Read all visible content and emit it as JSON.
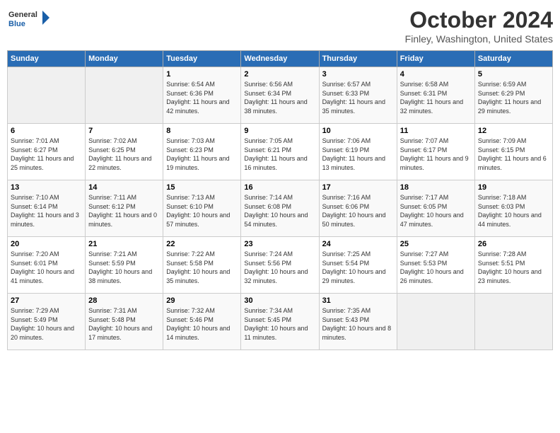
{
  "header": {
    "logo_line1": "General",
    "logo_line2": "Blue",
    "month": "October 2024",
    "location": "Finley, Washington, United States"
  },
  "weekdays": [
    "Sunday",
    "Monday",
    "Tuesday",
    "Wednesday",
    "Thursday",
    "Friday",
    "Saturday"
  ],
  "weeks": [
    [
      {
        "day": "",
        "info": ""
      },
      {
        "day": "",
        "info": ""
      },
      {
        "day": "1",
        "info": "Sunrise: 6:54 AM\nSunset: 6:36 PM\nDaylight: 11 hours and 42 minutes."
      },
      {
        "day": "2",
        "info": "Sunrise: 6:56 AM\nSunset: 6:34 PM\nDaylight: 11 hours and 38 minutes."
      },
      {
        "day": "3",
        "info": "Sunrise: 6:57 AM\nSunset: 6:33 PM\nDaylight: 11 hours and 35 minutes."
      },
      {
        "day": "4",
        "info": "Sunrise: 6:58 AM\nSunset: 6:31 PM\nDaylight: 11 hours and 32 minutes."
      },
      {
        "day": "5",
        "info": "Sunrise: 6:59 AM\nSunset: 6:29 PM\nDaylight: 11 hours and 29 minutes."
      }
    ],
    [
      {
        "day": "6",
        "info": "Sunrise: 7:01 AM\nSunset: 6:27 PM\nDaylight: 11 hours and 25 minutes."
      },
      {
        "day": "7",
        "info": "Sunrise: 7:02 AM\nSunset: 6:25 PM\nDaylight: 11 hours and 22 minutes."
      },
      {
        "day": "8",
        "info": "Sunrise: 7:03 AM\nSunset: 6:23 PM\nDaylight: 11 hours and 19 minutes."
      },
      {
        "day": "9",
        "info": "Sunrise: 7:05 AM\nSunset: 6:21 PM\nDaylight: 11 hours and 16 minutes."
      },
      {
        "day": "10",
        "info": "Sunrise: 7:06 AM\nSunset: 6:19 PM\nDaylight: 11 hours and 13 minutes."
      },
      {
        "day": "11",
        "info": "Sunrise: 7:07 AM\nSunset: 6:17 PM\nDaylight: 11 hours and 9 minutes."
      },
      {
        "day": "12",
        "info": "Sunrise: 7:09 AM\nSunset: 6:15 PM\nDaylight: 11 hours and 6 minutes."
      }
    ],
    [
      {
        "day": "13",
        "info": "Sunrise: 7:10 AM\nSunset: 6:14 PM\nDaylight: 11 hours and 3 minutes."
      },
      {
        "day": "14",
        "info": "Sunrise: 7:11 AM\nSunset: 6:12 PM\nDaylight: 11 hours and 0 minutes."
      },
      {
        "day": "15",
        "info": "Sunrise: 7:13 AM\nSunset: 6:10 PM\nDaylight: 10 hours and 57 minutes."
      },
      {
        "day": "16",
        "info": "Sunrise: 7:14 AM\nSunset: 6:08 PM\nDaylight: 10 hours and 54 minutes."
      },
      {
        "day": "17",
        "info": "Sunrise: 7:16 AM\nSunset: 6:06 PM\nDaylight: 10 hours and 50 minutes."
      },
      {
        "day": "18",
        "info": "Sunrise: 7:17 AM\nSunset: 6:05 PM\nDaylight: 10 hours and 47 minutes."
      },
      {
        "day": "19",
        "info": "Sunrise: 7:18 AM\nSunset: 6:03 PM\nDaylight: 10 hours and 44 minutes."
      }
    ],
    [
      {
        "day": "20",
        "info": "Sunrise: 7:20 AM\nSunset: 6:01 PM\nDaylight: 10 hours and 41 minutes."
      },
      {
        "day": "21",
        "info": "Sunrise: 7:21 AM\nSunset: 5:59 PM\nDaylight: 10 hours and 38 minutes."
      },
      {
        "day": "22",
        "info": "Sunrise: 7:22 AM\nSunset: 5:58 PM\nDaylight: 10 hours and 35 minutes."
      },
      {
        "day": "23",
        "info": "Sunrise: 7:24 AM\nSunset: 5:56 PM\nDaylight: 10 hours and 32 minutes."
      },
      {
        "day": "24",
        "info": "Sunrise: 7:25 AM\nSunset: 5:54 PM\nDaylight: 10 hours and 29 minutes."
      },
      {
        "day": "25",
        "info": "Sunrise: 7:27 AM\nSunset: 5:53 PM\nDaylight: 10 hours and 26 minutes."
      },
      {
        "day": "26",
        "info": "Sunrise: 7:28 AM\nSunset: 5:51 PM\nDaylight: 10 hours and 23 minutes."
      }
    ],
    [
      {
        "day": "27",
        "info": "Sunrise: 7:29 AM\nSunset: 5:49 PM\nDaylight: 10 hours and 20 minutes."
      },
      {
        "day": "28",
        "info": "Sunrise: 7:31 AM\nSunset: 5:48 PM\nDaylight: 10 hours and 17 minutes."
      },
      {
        "day": "29",
        "info": "Sunrise: 7:32 AM\nSunset: 5:46 PM\nDaylight: 10 hours and 14 minutes."
      },
      {
        "day": "30",
        "info": "Sunrise: 7:34 AM\nSunset: 5:45 PM\nDaylight: 10 hours and 11 minutes."
      },
      {
        "day": "31",
        "info": "Sunrise: 7:35 AM\nSunset: 5:43 PM\nDaylight: 10 hours and 8 minutes."
      },
      {
        "day": "",
        "info": ""
      },
      {
        "day": "",
        "info": ""
      }
    ]
  ]
}
